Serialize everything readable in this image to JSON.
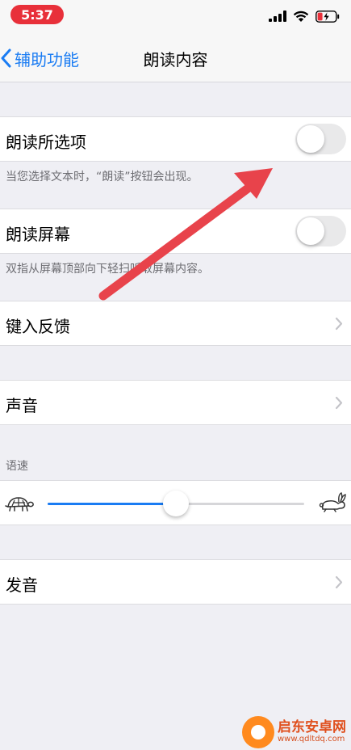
{
  "status_bar": {
    "time": "5:37"
  },
  "nav": {
    "back_label": "辅助功能",
    "title": "朗读内容"
  },
  "speak_selection": {
    "label": "朗读所选项",
    "on": false,
    "footnote": "当您选择文本时，“朗读”按钮会出现。"
  },
  "speak_screen": {
    "label": "朗读屏幕",
    "on": false,
    "footnote": "双指从屏幕顶部向下轻扫听取屏幕内容。"
  },
  "typing_feedback": {
    "label": "键入反馈"
  },
  "voices": {
    "label": "声音"
  },
  "speaking_rate": {
    "header": "语速",
    "value": 0.5,
    "slow_icon": "turtle-icon",
    "fast_icon": "rabbit-icon"
  },
  "pronunciations": {
    "label": "发音"
  },
  "colors": {
    "accent": "#1a7cf3",
    "annotation_arrow": "#e8434b"
  },
  "watermark": {
    "name": "启东安卓网",
    "url": "www.qdltdq.com"
  }
}
